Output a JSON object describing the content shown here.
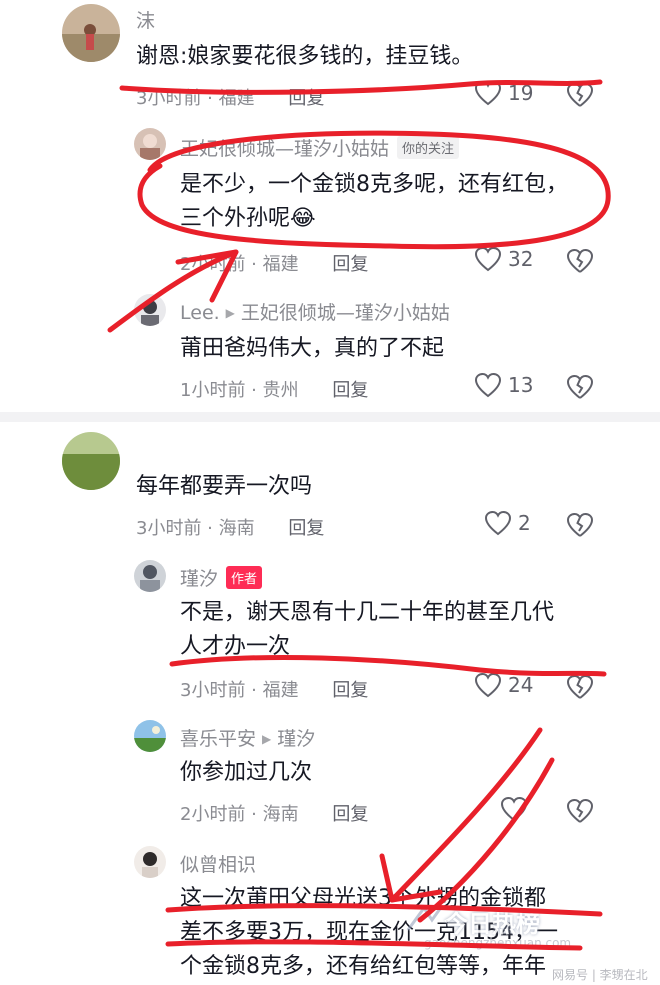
{
  "comments": [
    {
      "name": "沫",
      "text": "谢恩:娘家要花很多钱的，挂豆钱。",
      "time": "3小时前",
      "location": "福建",
      "reply": "回复",
      "likes": "19"
    },
    {
      "name": "王妃很倾城—瑾汐小姑姑",
      "tag": "你的关注",
      "text_lines": [
        "是不少，一个金锁8克多呢，还有红包，",
        "三个外孙呢😂"
      ],
      "time": "2小时前",
      "location": "福建",
      "reply": "回复",
      "likes": "32"
    },
    {
      "name": "Lee.",
      "reply_to": "王妃很倾城—瑾汐小姑姑",
      "text": "莆田爸妈伟大，真的了不起",
      "time": "1小时前",
      "location": "贵州",
      "reply": "回复",
      "likes": "13"
    },
    {
      "text": "每年都要弄一次吗",
      "time": "3小时前",
      "location": "海南",
      "reply": "回复",
      "likes": "2"
    },
    {
      "name": "瑾汐",
      "tag": "作者",
      "text_lines": [
        "不是，谢天恩有十几二十年的甚至几代",
        "人才办一次"
      ],
      "time": "3小时前",
      "location": "福建",
      "reply": "回复",
      "likes": "24"
    },
    {
      "name": "喜乐平安",
      "reply_to": "瑾汐",
      "text": "你参加过几次",
      "time": "2小时前",
      "location": "海南",
      "reply": "回复"
    },
    {
      "name": "似曾相识",
      "text_lines": [
        "这一次莆田父母光送3个外甥的金锁都",
        "差不多要3万，现在金价一克1154，一",
        "个金锁8克多，还有给红包等等，年年"
      ]
    }
  ],
  "watermark": {
    "logo": "今日热榜",
    "url": "gaochengzhenxuan.com",
    "bottom": "网易号 | 李甥在北漂"
  },
  "colors": {
    "annotation_red": "#e8202a",
    "tag_author": "#fe2c55",
    "meta": "#8a8b91"
  }
}
